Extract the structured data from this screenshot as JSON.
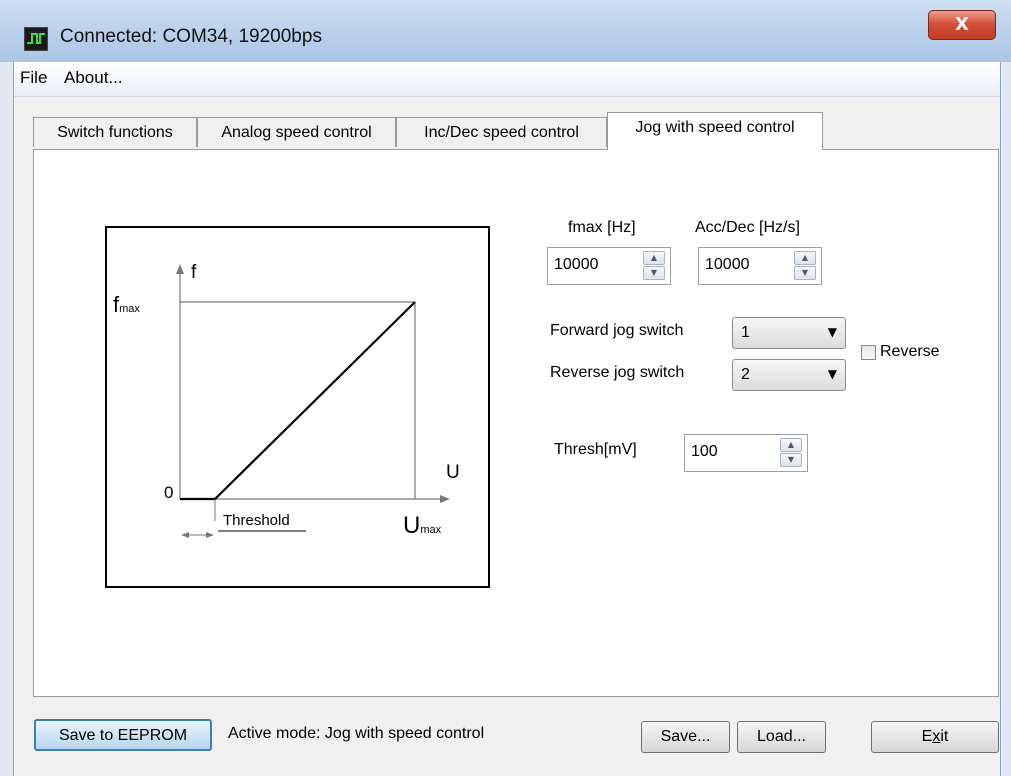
{
  "window": {
    "title": "Connected: COM34, 19200bps",
    "close_glyph": "X"
  },
  "menu": {
    "items": [
      "File",
      "About..."
    ]
  },
  "tabs": [
    {
      "label": "Switch functions"
    },
    {
      "label": "Analog speed control"
    },
    {
      "label": "Inc/Dec speed control"
    },
    {
      "label": "Jog with speed control"
    }
  ],
  "diagram": {
    "f_axis": "f",
    "fmax_main": "f",
    "fmax_sub": "max",
    "u_axis": "U",
    "umax_main": "U",
    "umax_sub": "max",
    "origin": "0",
    "threshold": "Threshold"
  },
  "fmax": {
    "label": "fmax [Hz]",
    "value": "10000"
  },
  "accdec": {
    "label": "Acc/Dec [Hz/s]",
    "value": "10000"
  },
  "forward_jog": {
    "label": "Forward jog switch",
    "value": "1"
  },
  "reverse_jog": {
    "label": "Reverse jog switch",
    "value": "2"
  },
  "reverse_check": {
    "label": "Reverse",
    "checked": false
  },
  "thresh": {
    "label": "Thresh[mV]",
    "value": "100"
  },
  "footer": {
    "save_eeprom": "Save to EEPROM",
    "active_mode": "Active mode: Jog with speed control",
    "save": "Save...",
    "load": "Load...",
    "exit_pre": "E",
    "exit_u": "x",
    "exit_post": "it"
  },
  "icons": {
    "app": "oscilloscope-icon",
    "close": "close-icon",
    "spin_up": "spin-up-icon",
    "spin_down": "spin-down-icon",
    "dropdown": "chevron-down-icon"
  }
}
